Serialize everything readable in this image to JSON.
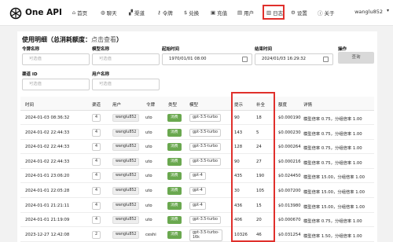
{
  "app": {
    "title": "One API"
  },
  "nav": {
    "items": [
      {
        "icon": "home-icon",
        "glyph": "⌂",
        "label": "首页"
      },
      {
        "icon": "chat-icon",
        "glyph": "◍",
        "label": "聊天"
      },
      {
        "icon": "channel-icon",
        "glyph": "▞",
        "label": "渠道"
      },
      {
        "icon": "key-icon",
        "glyph": "⚷",
        "label": "令牌"
      },
      {
        "icon": "dollar-icon",
        "glyph": "$",
        "label": "兑换"
      },
      {
        "icon": "recharge-icon",
        "glyph": "▣",
        "label": "充值"
      },
      {
        "icon": "user-icon",
        "glyph": "▤",
        "label": "用户"
      },
      {
        "icon": "log-icon",
        "glyph": "▥",
        "label": "日志"
      },
      {
        "icon": "gear-icon",
        "glyph": "⚙",
        "label": "设置"
      },
      {
        "icon": "info-icon",
        "glyph": "ⓘ",
        "label": "关于"
      }
    ],
    "active": "日志",
    "user": "wanglu852"
  },
  "panel": {
    "title": "使用明细（总消耗额度：",
    "title_link": "点击查看",
    "title_end": "）"
  },
  "filters": {
    "token_name": {
      "label": "令牌名称",
      "placeholder": "可选值"
    },
    "model_name": {
      "label": "模型名称",
      "placeholder": "可选值"
    },
    "start_time": {
      "label": "起始时间",
      "value": "1970/01/01 08:00"
    },
    "end_time": {
      "label": "结束时间",
      "value": "2024/01/03 16:29:32"
    },
    "action": {
      "label": "操作",
      "button": "查询"
    },
    "channel_id": {
      "label": "渠道 ID",
      "placeholder": "可选值"
    },
    "username": {
      "label": "用户名称",
      "placeholder": "可选值"
    }
  },
  "table": {
    "headers": [
      "时间",
      "渠道",
      "用户",
      "令牌",
      "类型",
      "模型",
      "提示",
      "补全",
      "额度",
      "详情"
    ],
    "rows": [
      {
        "time": "2024-01-03 08:36:32",
        "channel": "4",
        "user": "wanglu852",
        "token": "uto",
        "type": "消费",
        "model": [
          "gpt-3.5-turbo"
        ],
        "prompt": "90",
        "completion": "18",
        "quota": "$0.000190",
        "detail": "模型倍率 0.75，分组倍率 1.00"
      },
      {
        "time": "2024-01-02 22:44:33",
        "channel": "4",
        "user": "wanglu852",
        "token": "uto",
        "type": "消费",
        "model": [
          "gpt-3.5-turbo"
        ],
        "prompt": "143",
        "completion": "5",
        "quota": "$0.000230",
        "detail": "模型倍率 0.75，分组倍率 1.00"
      },
      {
        "time": "2024-01-02 22:44:33",
        "channel": "4",
        "user": "wanglu852",
        "token": "uto",
        "type": "消费",
        "model": [
          "gpt-3.5-turbo"
        ],
        "prompt": "128",
        "completion": "24",
        "quota": "$0.000264",
        "detail": "模型倍率 0.75，分组倍率 1.00"
      },
      {
        "time": "2024-01-02 22:44:33",
        "channel": "4",
        "user": "wanglu852",
        "token": "uto",
        "type": "消费",
        "model": [
          "gpt-3.5-turbo"
        ],
        "prompt": "90",
        "completion": "27",
        "quota": "$0.000216",
        "detail": "模型倍率 0.75，分组倍率 1.00"
      },
      {
        "time": "2024-01-01 23:06:20",
        "channel": "4",
        "user": "wanglu852",
        "token": "uto",
        "type": "消费",
        "model": [
          "gpt-4"
        ],
        "prompt": "435",
        "completion": "190",
        "quota": "$0.024450",
        "detail": "模型倍率 15.00，分组倍率 1.00"
      },
      {
        "time": "2024-01-01 22:05:28",
        "channel": "4",
        "user": "wanglu852",
        "token": "uto",
        "type": "消费",
        "model": [
          "gpt-4"
        ],
        "prompt": "30",
        "completion": "105",
        "quota": "$0.007200",
        "detail": "模型倍率 15.00，分组倍率 1.00"
      },
      {
        "time": "2024-01-01 21:21:11",
        "channel": "4",
        "user": "wanglu852",
        "token": "uto",
        "type": "消费",
        "model": [
          "gpt-4"
        ],
        "prompt": "436",
        "completion": "15",
        "quota": "$0.013980",
        "detail": "模型倍率 15.00，分组倍率 1.00"
      },
      {
        "time": "2024-01-01 21:19:09",
        "channel": "4",
        "user": "wanglu852",
        "token": "uto",
        "type": "消费",
        "model": [
          "gpt-3.5-turbo"
        ],
        "prompt": "406",
        "completion": "20",
        "quota": "$0.000670",
        "detail": "模型倍率 0.75，分组倍率 1.00"
      },
      {
        "time": "2023-12-27 12:42:08",
        "channel": "2",
        "user": "wanglu852",
        "token": "ceshi",
        "type": "消费",
        "model": [
          "gpt-3.5-turbo-",
          "16k"
        ],
        "prompt": "10326",
        "completion": "46",
        "quota": "$0.031254",
        "detail": "模型倍率 1.50，分组倍率 1.00"
      }
    ]
  },
  "colors": {
    "highlight": "#e0302c",
    "type_tag": "#6aa84f"
  }
}
